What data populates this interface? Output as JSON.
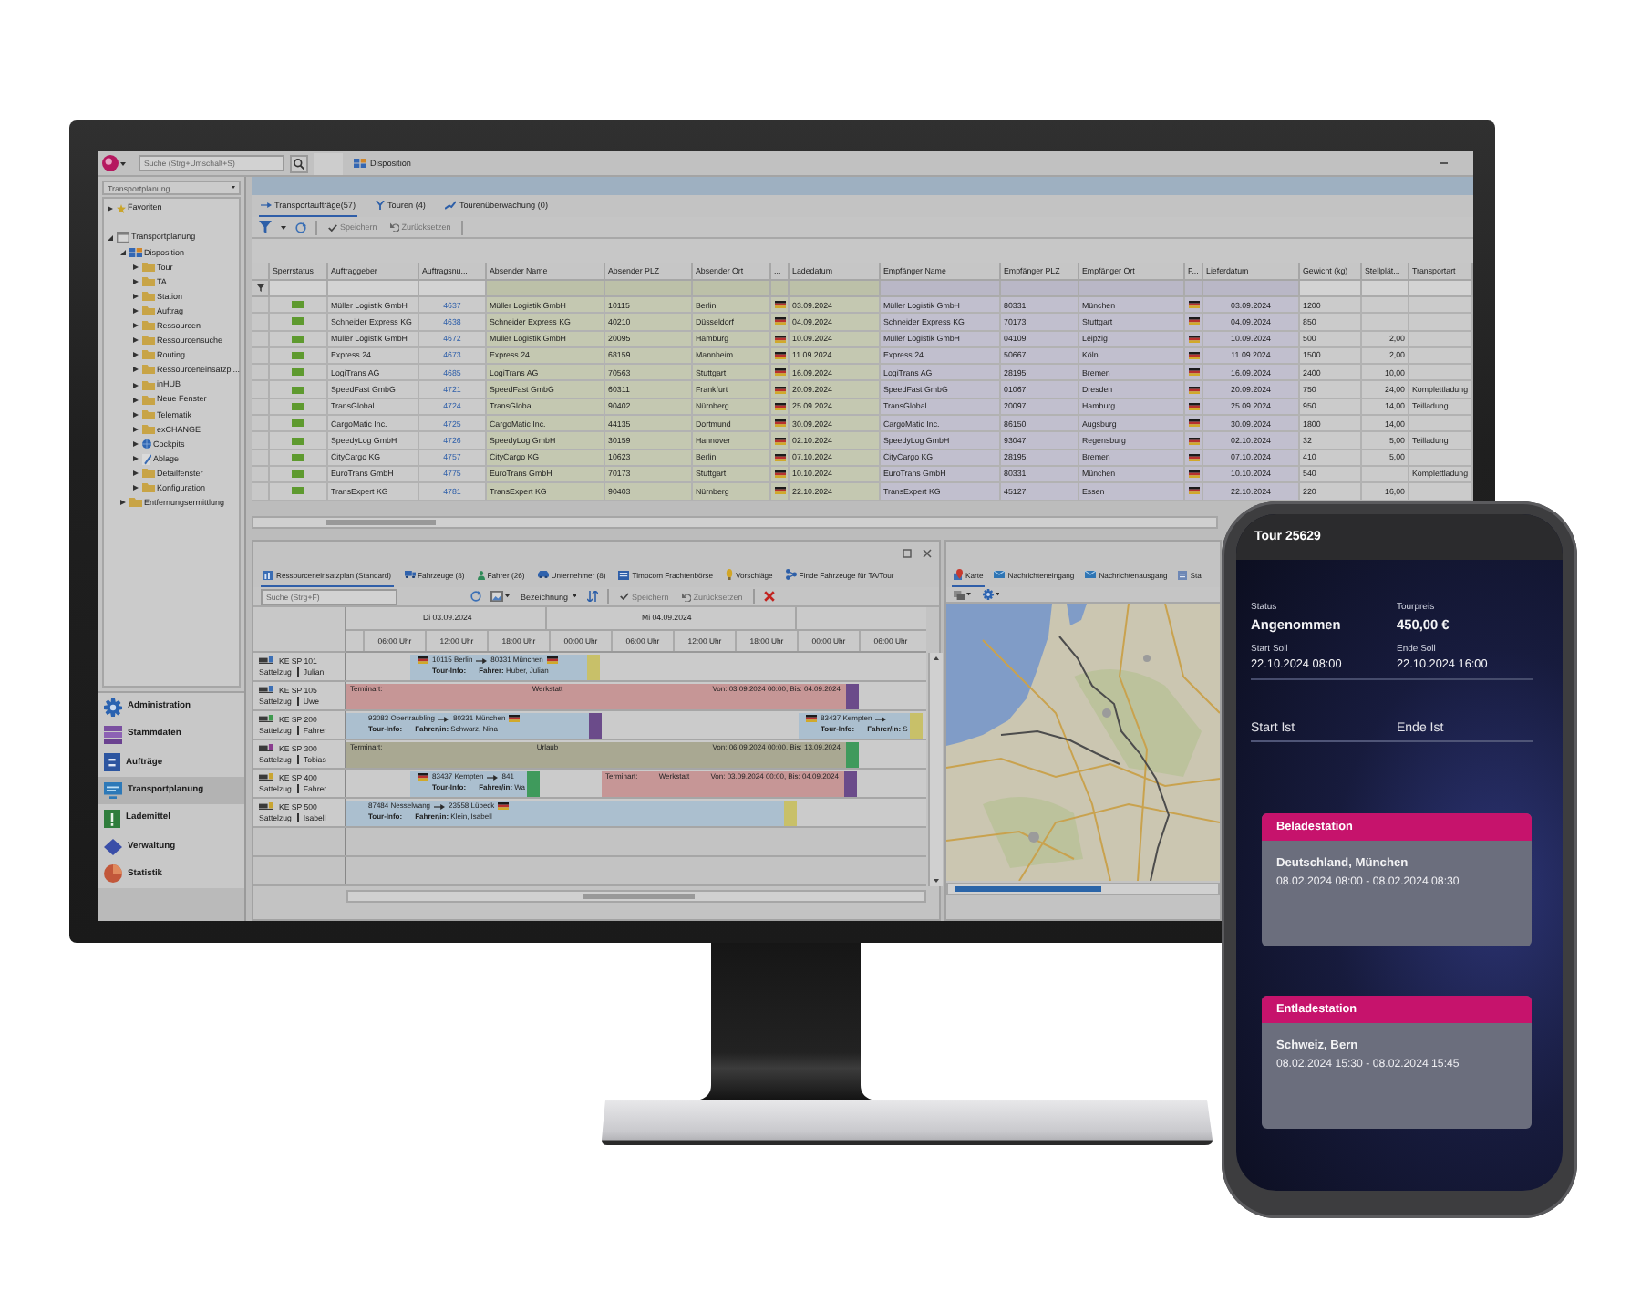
{
  "monitor": {
    "topbar": {
      "search": {
        "placeholder": "Suche (Strg+Umschalt+S)"
      },
      "tabs": [
        {
          "label": "Disposition"
        }
      ]
    },
    "sidebar": {
      "module": "Transportplanung",
      "tree": [
        {
          "label": "Favoriten",
          "kind": "star",
          "expanded": false
        },
        {
          "label": "Transportplanung",
          "kind": "window",
          "expanded": true,
          "children": [
            {
              "label": "Disposition",
              "kind": "tiles",
              "expanded": true,
              "children": [
                {
                  "label": "Tour",
                  "kind": "folder",
                  "expanded": false
                },
                {
                  "label": "TA",
                  "kind": "folder",
                  "expanded": false
                },
                {
                  "label": "Station",
                  "kind": "folder",
                  "expanded": false
                },
                {
                  "label": "Auftrag",
                  "kind": "folder",
                  "expanded": false
                },
                {
                  "label": "Ressourcen",
                  "kind": "folder",
                  "expanded": false
                },
                {
                  "label": "Ressourcensuche",
                  "kind": "folder",
                  "expanded": false
                },
                {
                  "label": "Routing",
                  "kind": "folder",
                  "expanded": false
                },
                {
                  "label": "Ressourceneinsatzpl...",
                  "kind": "folder",
                  "expanded": false
                },
                {
                  "label": "inHUB",
                  "kind": "folder",
                  "expanded": false
                },
                {
                  "label": "Neue Fenster",
                  "kind": "folder",
                  "expanded": false
                },
                {
                  "label": "Telematik",
                  "kind": "folder",
                  "expanded": false
                },
                {
                  "label": "exCHANGE",
                  "kind": "folder",
                  "expanded": false
                },
                {
                  "label": "Cockpits",
                  "kind": "globe",
                  "expanded": false
                },
                {
                  "label": "Ablage",
                  "kind": "document",
                  "expanded": false
                },
                {
                  "label": "Detailfenster",
                  "kind": "folder",
                  "expanded": false
                },
                {
                  "label": "Konfiguration",
                  "kind": "folder",
                  "expanded": false
                }
              ]
            },
            {
              "label": "Entfernungsermittlung",
              "kind": "folder",
              "expanded": false
            }
          ]
        }
      ],
      "nav": [
        {
          "label": "Administration",
          "selected": false
        },
        {
          "label": "Stammdaten",
          "selected": false
        },
        {
          "label": "Aufträge",
          "selected": false
        },
        {
          "label": "Transportplanung",
          "selected": true
        },
        {
          "label": "Lademittel",
          "selected": false
        },
        {
          "label": "Verwaltung",
          "selected": false
        },
        {
          "label": "Statistik",
          "selected": false
        }
      ]
    },
    "orders": {
      "tabs": [
        {
          "label": "Transportaufträge(57)",
          "selected": true
        },
        {
          "label": "Touren (4)",
          "selected": false
        },
        {
          "label": "Tourenüberwachung (0)",
          "selected": false
        }
      ],
      "buttons": [
        {
          "label": "Speichern",
          "disabled": true
        },
        {
          "label": "Zurücksetzen",
          "disabled": true
        }
      ],
      "table": {
        "columns": [
          {
            "label": "Sperrstatus",
            "kind": "status"
          },
          {
            "label": "Auftraggeber",
            "kind": "text"
          },
          {
            "label": "Auftragsnu...",
            "kind": "link"
          },
          {
            "label": "Absender Name",
            "kind": "text"
          },
          {
            "label": "Absender PLZ",
            "kind": "text"
          },
          {
            "label": "Absender Ort",
            "kind": "text"
          },
          {
            "label": "...",
            "kind": "flag"
          },
          {
            "label": "Ladedatum",
            "kind": "text"
          },
          {
            "label": "Empfänger Name",
            "kind": "text"
          },
          {
            "label": "Empfänger PLZ",
            "kind": "text"
          },
          {
            "label": "Empfänger Ort",
            "kind": "text"
          },
          {
            "label": "F...",
            "kind": "flag"
          },
          {
            "label": "Lieferdatum",
            "kind": "text"
          },
          {
            "label": "Gewicht (kg)",
            "kind": "text"
          },
          {
            "label": "Stellplät...",
            "kind": "text"
          },
          {
            "label": "Transportart",
            "kind": "text"
          }
        ],
        "rows": [
          {
            "locked": false,
            "client": "Müller Logistik GmbH",
            "order_no": "4637",
            "sender_name": "Müller Logistik GmbH",
            "sender_zip": "10115",
            "sender_city": "Berlin",
            "load_date": "03.09.2024",
            "recipient_name": "Müller Logistik GmbH",
            "recipient_zip": "80331",
            "recipient_city": "München",
            "delivery_date": "03.09.2024",
            "weight": "1200"
          },
          {
            "locked": false,
            "client": "Schneider Express KG",
            "order_no": "4638",
            "sender_name": "Schneider Express KG",
            "sender_zip": "40210",
            "sender_city": "Düsseldorf",
            "load_date": "04.09.2024",
            "recipient_name": "Schneider Express KG",
            "recipient_zip": "70173",
            "recipient_city": "Stuttgart",
            "delivery_date": "04.09.2024",
            "weight": "850"
          },
          {
            "locked": false,
            "client": "Müller Logistik GmbH",
            "order_no": "4672",
            "sender_name": "Müller Logistik GmbH",
            "sender_zip": "20095",
            "sender_city": "Hamburg",
            "load_date": "10.09.2024",
            "recipient_name": "Müller Logistik GmbH",
            "recipient_zip": "04109",
            "recipient_city": "Leipzig",
            "delivery_date": "10.09.2024",
            "weight": "500",
            "pallets": "2,00"
          },
          {
            "locked": false,
            "client": "Express 24",
            "order_no": "4673",
            "sender_name": "Express 24",
            "sender_zip": "68159",
            "sender_city": "Mannheim",
            "load_date": "11.09.2024",
            "recipient_name": "Express 24",
            "recipient_zip": "50667",
            "recipient_city": "Köln",
            "delivery_date": "11.09.2024",
            "weight": "1500",
            "pallets": "2,00"
          },
          {
            "locked": false,
            "client": "LogiTrans AG",
            "order_no": "4685",
            "sender_name": "LogiTrans AG",
            "sender_zip": "70563",
            "sender_city": "Stuttgart",
            "load_date": "16.09.2024",
            "recipient_name": "LogiTrans AG",
            "recipient_zip": "28195",
            "recipient_city": "Bremen",
            "delivery_date": "16.09.2024",
            "weight": "2400",
            "pallets": "10,00"
          },
          {
            "locked": false,
            "client": "SpeedFast GmbG",
            "order_no": "4721",
            "sender_name": "SpeedFast GmbG",
            "sender_zip": "60311",
            "sender_city": "Frankfurt",
            "load_date": "20.09.2024",
            "recipient_name": "SpeedFast GmbG",
            "recipient_zip": "01067",
            "recipient_city": "Dresden",
            "delivery_date": "20.09.2024",
            "weight": "750",
            "pallets": "24,00",
            "transport_type": "Komplettladung"
          },
          {
            "locked": false,
            "client": "TransGlobal",
            "order_no": "4724",
            "sender_name": "TransGlobal",
            "sender_zip": "90402",
            "sender_city": "Nürnberg",
            "load_date": "25.09.2024",
            "recipient_name": "TransGlobal",
            "recipient_zip": "20097",
            "recipient_city": "Hamburg",
            "delivery_date": "25.09.2024",
            "weight": "950",
            "pallets": "14,00",
            "transport_type": "Teilladung"
          },
          {
            "locked": false,
            "client": "CargoMatic Inc.",
            "order_no": "4725",
            "sender_name": "CargoMatic Inc.",
            "sender_zip": "44135",
            "sender_city": "Dortmund",
            "load_date": "30.09.2024",
            "recipient_name": "CargoMatic Inc.",
            "recipient_zip": "86150",
            "recipient_city": "Augsburg",
            "delivery_date": "30.09.2024",
            "weight": "1800",
            "pallets": "14,00"
          },
          {
            "locked": false,
            "client": "SpeedyLog GmbH",
            "order_no": "4726",
            "sender_name": "SpeedyLog GmbH",
            "sender_zip": "30159",
            "sender_city": "Hannover",
            "load_date": "02.10.2024",
            "recipient_name": "SpeedyLog GmbH",
            "recipient_zip": "93047",
            "recipient_city": "Regensburg",
            "delivery_date": "02.10.2024",
            "weight": "32",
            "pallets": "5,00",
            "transport_type": "Teilladung"
          },
          {
            "locked": false,
            "client": "CityCargo KG",
            "order_no": "4757",
            "sender_name": "CityCargo KG",
            "sender_zip": "10623",
            "sender_city": "Berlin",
            "load_date": "07.10.2024",
            "recipient_name": "CityCargo KG",
            "recipient_zip": "28195",
            "recipient_city": "Bremen",
            "delivery_date": "07.10.2024",
            "weight": "410",
            "pallets": "5,00"
          },
          {
            "locked": false,
            "client": "EuroTrans GmbH",
            "order_no": "4775",
            "sender_name": "EuroTrans GmbH",
            "sender_zip": "70173",
            "sender_city": "Stuttgart",
            "load_date": "10.10.2024",
            "recipient_name": "EuroTrans GmbH",
            "recipient_zip": "80331",
            "recipient_city": "München",
            "delivery_date": "10.10.2024",
            "weight": "540",
            "transport_type": "Komplettladung"
          },
          {
            "locked": false,
            "client": "TransExpert KG",
            "order_no": "4781",
            "sender_name": "TransExpert KG",
            "sender_zip": "90403",
            "sender_city": "Nürnberg",
            "load_date": "22.10.2024",
            "recipient_name": "TransExpert KG",
            "recipient_zip": "45127",
            "recipient_city": "Essen",
            "delivery_date": "22.10.2024",
            "weight": "220",
            "pallets": "16,00"
          }
        ]
      }
    },
    "planning": {
      "tabs": [
        {
          "label": "Ressourceneinsatzplan (Standard)",
          "selected": true
        },
        {
          "label": "Fahrzeuge (8)",
          "selected": false
        },
        {
          "label": "Fahrer (26)",
          "selected": false
        },
        {
          "label": "Unternehmer (8)",
          "selected": false
        },
        {
          "label": "Timocom Frachtenbörse",
          "selected": false
        },
        {
          "label": "Vorschläge",
          "selected": false
        },
        {
          "label": "Finde Fahrzeuge für TA/Tour",
          "selected": false
        }
      ],
      "search": {
        "placeholder": "Suche (Strg+F)"
      },
      "sort": "Bezeichnung",
      "buttons": [
        {
          "label": "Speichern",
          "disabled": true
        },
        {
          "label": "Zurücksetzen",
          "disabled": true
        }
      ],
      "days": [
        "Di 03.09.2024",
        "Mi 04.09.2024"
      ],
      "hours": [
        "06:00 Uhr",
        "12:00 Uhr",
        "18:00 Uhr",
        "00:00 Uhr",
        "06:00 Uhr",
        "12:00 Uhr",
        "18:00 Uhr",
        "00:00 Uhr",
        "06:00 Uhr"
      ],
      "resources": [
        {
          "plate": "KE SP 101",
          "type": "Sattelzug",
          "driver": "Julian",
          "color": "#3b6fb6",
          "segments": [
            {
              "kind": "tour",
              "color": "#abbfcf",
              "from": "10115 Berlin",
              "to": "80331 München",
              "from_flag": true,
              "to_flag": true,
              "info_label": "Tour-Info:",
              "driver_label": "Fahrer:",
              "driver": "Huber, Julian",
              "marker": {
                "color": "#c8c069"
              }
            }
          ]
        },
        {
          "plate": "KE SP 105",
          "type": "Sattelzug",
          "driver": "Uwe",
          "color": "#3b6fb6",
          "segments": [
            {
              "kind": "appointment",
              "color": "#c69696",
              "type_label": "Terminart:",
              "type": "Werkstatt",
              "period": "Von: 03.09.2024 00:00, Bis: 04.09.2024",
              "marker": {
                "color": "#6b4b8a"
              }
            }
          ]
        },
        {
          "plate": "KE SP 200",
          "type": "Sattelzug",
          "driver": "Fahrer",
          "color": "#3f9a4e",
          "segments": [
            {
              "kind": "tour",
              "color": "#abbfcf",
              "from": "93083 Obertraubling",
              "to": "80331 München",
              "from_flag": false,
              "to_flag": true,
              "info_label": "Tour-Info:",
              "driver_label": "Fahrer/in:",
              "driver": "Schwarz, Nina",
              "marker": {
                "color": "#6b4b8a"
              }
            },
            {
              "kind": "tour",
              "color": "#abbfcf",
              "from": "83437 Kempten",
              "from_flag": true,
              "to_flag": false,
              "info_label": "Tour-Info:",
              "driver_label": "Fahrer/in:",
              "driver": "S",
              "marker": {
                "color": "#c8c069"
              }
            }
          ]
        },
        {
          "plate": "KE SP 300",
          "type": "Sattelzug",
          "driver": "Tobias",
          "color": "#8a3d8f",
          "segments": [
            {
              "kind": "appointment",
              "color": "#a9a892",
              "type_label": "Terminart:",
              "type": "Urlaub",
              "period": "Von: 06.09.2024 00:00, Bis: 13.09.2024",
              "marker": {
                "color": "#3f9a5c"
              }
            }
          ]
        },
        {
          "plate": "KE SP 400",
          "type": "Sattelzug",
          "driver": "Fahrer",
          "color": "#c9a531",
          "segments": [
            {
              "kind": "tour",
              "color": "#abbfcf",
              "from": "83437 Kempten",
              "to": "841",
              "from_flag": true,
              "to_flag": false,
              "info_label": "Tour-Info:",
              "driver_label": "Fahrer/in:",
              "driver": "Wa",
              "marker": {
                "color": "#3f9a5c"
              }
            },
            {
              "kind": "appointment",
              "color": "#c69696",
              "type_label": "Terminart:",
              "type": "Werkstatt",
              "period": "Von: 03.09.2024 00:00, Bis: 04.09.2024",
              "marker": {
                "color": "#6b4b8a"
              }
            }
          ]
        },
        {
          "plate": "KE SP 500",
          "type": "Sattelzug",
          "driver": "Isabell",
          "color": "#c9a531",
          "segments": [
            {
              "kind": "tour",
              "color": "#abbfcf",
              "from": "87484 Nesselwang",
              "to": "23558 Lübeck",
              "from_flag": false,
              "to_flag": true,
              "info_label": "Tour-Info:",
              "driver_label": "Fahrer/in:",
              "driver": "Klein, Isabell",
              "marker": {
                "color": "#c8c069"
              }
            }
          ]
        }
      ]
    },
    "map": {
      "tabs": [
        {
          "label": "Karte",
          "selected": true
        },
        {
          "label": "Nachrichteneingang",
          "selected": false
        },
        {
          "label": "Nachrichtenausgang",
          "selected": false
        },
        {
          "label": "Sta",
          "selected": false
        }
      ]
    }
  },
  "phone": {
    "title": "Tour 25629",
    "fields": [
      {
        "label": "Status",
        "value": "Angenommen"
      },
      {
        "label": "Tourpreis",
        "value": "450,00 €"
      },
      {
        "label": "Start Soll",
        "value": "22.10.2024 08:00"
      },
      {
        "label": "Ende Soll",
        "value": "22.10.2024 16:00"
      }
    ],
    "inputs": [
      {
        "label": "Start Ist"
      },
      {
        "label": "Ende Ist"
      }
    ],
    "stations": [
      {
        "title": "Beladestation",
        "place": "Deutschland, München",
        "time": "08.02.2024 08:00 - 08.02.2024 08:30"
      },
      {
        "title": "Entladestation",
        "place": "Schweiz, Bern",
        "time": "08.02.2024 15:30 - 08.02.2024 15:45"
      }
    ]
  }
}
